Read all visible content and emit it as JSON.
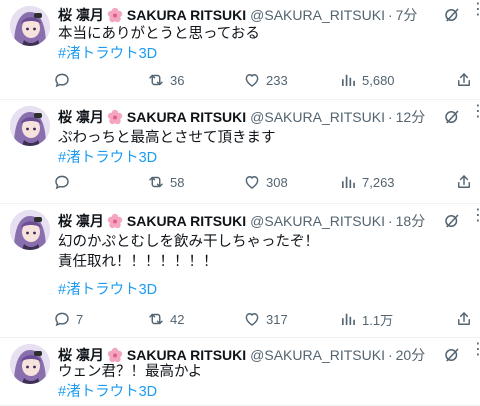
{
  "tweets": [
    {
      "name": "桜 凛月",
      "display_name": "SAKURA RITSUKI",
      "handle": "@SAKURA_RITSUKI",
      "separator": "·",
      "time": "7分",
      "lines": [
        "本当にありがとうと思っておる"
      ],
      "hashtag": "#渚トラウト3D",
      "replies": "",
      "retweets": "36",
      "likes": "233",
      "views": "5,680"
    },
    {
      "name": "桜 凛月",
      "display_name": "SAKURA RITSUKI",
      "handle": "@SAKURA_RITSUKI",
      "separator": "·",
      "time": "12分",
      "lines": [
        "ぷわっちと最高とさせて頂きます"
      ],
      "hashtag": "#渚トラウト3D",
      "replies": "",
      "retweets": "58",
      "likes": "308",
      "views": "7,263"
    },
    {
      "name": "桜 凛月",
      "display_name": "SAKURA RITSUKI",
      "handle": "@SAKURA_RITSUKI",
      "separator": "·",
      "time": "18分",
      "lines": [
        "幻のかぷとむしを飲み干しちゃったぞ！",
        "責任取れ！！！！！！！"
      ],
      "hashtag": "#渚トラウト3D",
      "replies": "7",
      "retweets": "42",
      "likes": "317",
      "views": "1.1万"
    },
    {
      "name": "桜 凛月",
      "display_name": "SAKURA RITSUKI",
      "handle": "@SAKURA_RITSUKI",
      "separator": "·",
      "time": "20分",
      "lines": [
        "ウェン君？！最高かよ"
      ],
      "hashtag": "#渚トラウト3D"
    }
  ],
  "icons": {
    "name_emoji": "cherry-blossom-icon",
    "reply": "reply-icon",
    "retweet": "retweet-icon",
    "like": "heart-icon",
    "views": "views-icon",
    "share": "share-icon",
    "grok": "grok-icon",
    "more": "more-icon"
  },
  "colors": {
    "hashtag": "#1d9bf0",
    "secondary_text": "#536471",
    "primary_text": "#0f1419",
    "divider": "#eff3f4"
  }
}
